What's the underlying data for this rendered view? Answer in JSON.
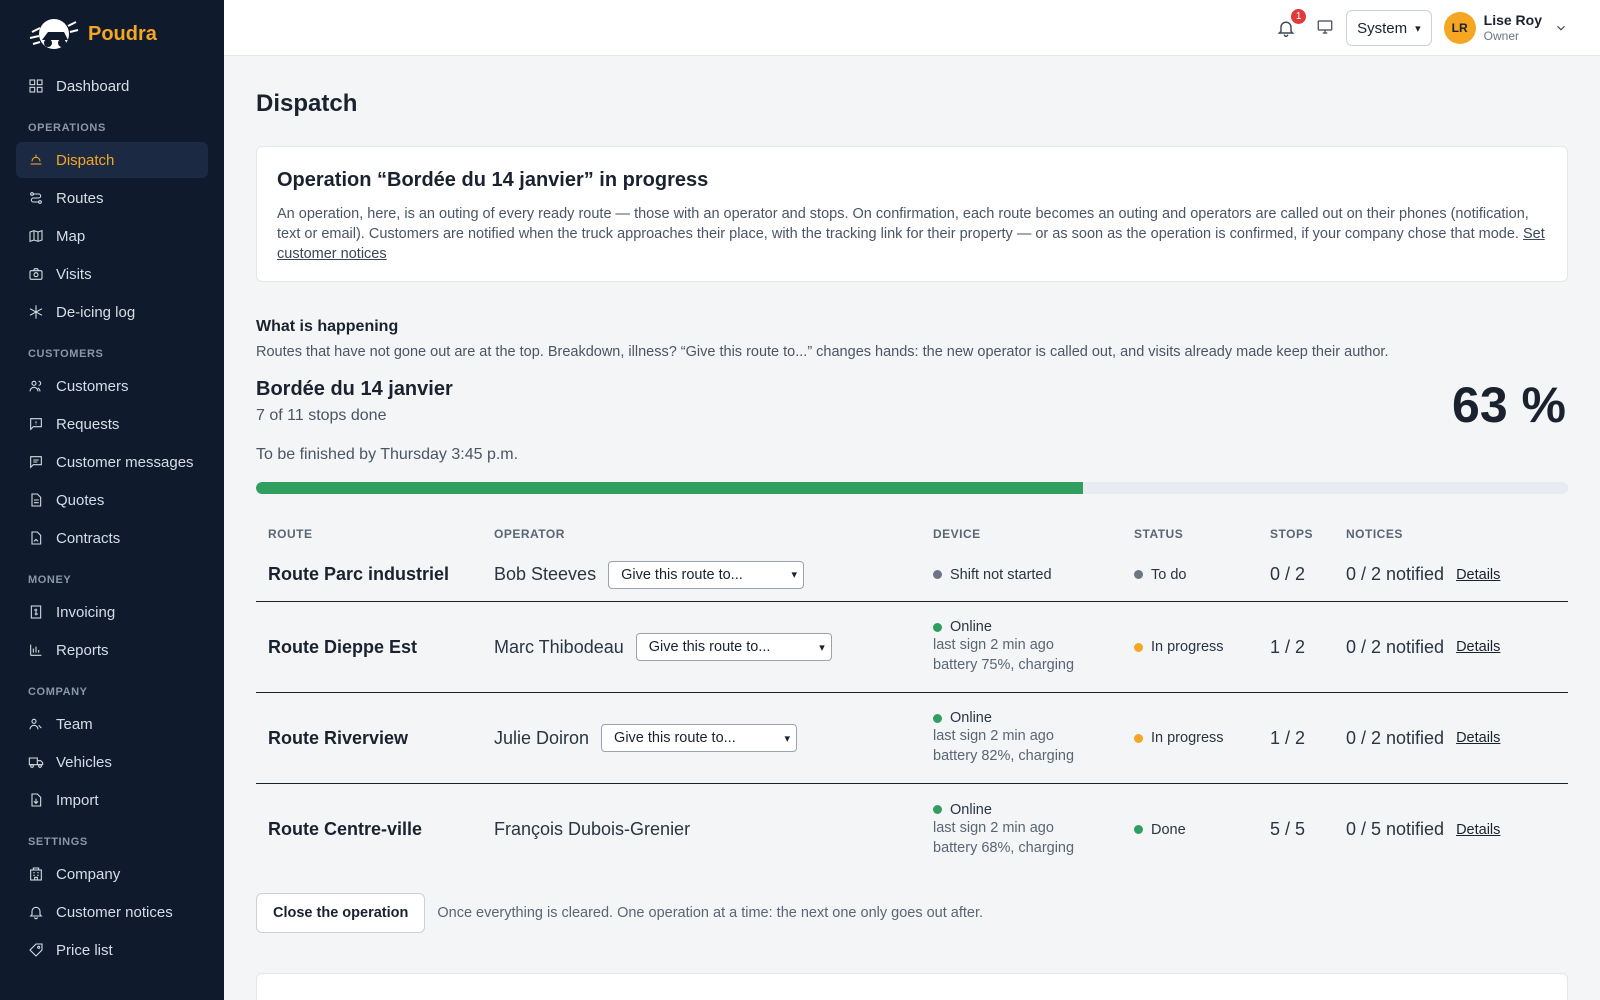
{
  "brand": {
    "name": "Poudra"
  },
  "sidebar": {
    "top_items": [
      {
        "label": "Dashboard",
        "icon": "dashboard-icon"
      }
    ],
    "sections": [
      {
        "title": "OPERATIONS",
        "items": [
          {
            "label": "Dispatch",
            "icon": "dispatch-icon",
            "active": true
          },
          {
            "label": "Routes",
            "icon": "routes-icon"
          },
          {
            "label": "Map",
            "icon": "map-icon"
          },
          {
            "label": "Visits",
            "icon": "camera-icon"
          },
          {
            "label": "De-icing log",
            "icon": "snowflake-icon"
          }
        ]
      },
      {
        "title": "CUSTOMERS",
        "items": [
          {
            "label": "Customers",
            "icon": "users-icon"
          },
          {
            "label": "Requests",
            "icon": "message-square-icon"
          },
          {
            "label": "Customer messages",
            "icon": "messages-icon"
          },
          {
            "label": "Quotes",
            "icon": "document-icon"
          },
          {
            "label": "Contracts",
            "icon": "contract-icon"
          }
        ]
      },
      {
        "title": "MONEY",
        "items": [
          {
            "label": "Invoicing",
            "icon": "invoice-icon"
          },
          {
            "label": "Reports",
            "icon": "bar-chart-icon"
          }
        ]
      },
      {
        "title": "COMPANY",
        "items": [
          {
            "label": "Team",
            "icon": "team-icon"
          },
          {
            "label": "Vehicles",
            "icon": "truck-icon"
          },
          {
            "label": "Import",
            "icon": "import-icon"
          }
        ]
      },
      {
        "title": "SETTINGS",
        "items": [
          {
            "label": "Company",
            "icon": "building-icon"
          },
          {
            "label": "Customer notices",
            "icon": "bell-icon"
          },
          {
            "label": "Price list",
            "icon": "tag-icon"
          }
        ]
      }
    ]
  },
  "topbar": {
    "notification_count": "1",
    "theme_value": "System",
    "user_initials": "LR",
    "user_name": "Lise Roy",
    "user_role": "Owner"
  },
  "page": {
    "title": "Dispatch"
  },
  "info_card": {
    "title": "Operation “Bordée du 14 janvier” in progress",
    "text": "An operation, here, is an outing of every ready route — those with an operator and stops. On confirmation, each route becomes an outing and operators are called out on their phones (notification, text or email). Customers are notified when the truck approaches their place, with the tracking link for their property — or as soon as the operation is confirmed, if your company chose that mode.",
    "link": "Set customer notices"
  },
  "happening": {
    "title": "What is happening",
    "text": "Routes that have not gone out are at the top. Breakdown, illness? “Give this route to...” changes hands: the new operator is called out, and visits already made keep their author."
  },
  "operation": {
    "name": "Bordée du 14 janvier",
    "progress_text": "7 of 11 stops done",
    "finish_text": "To be finished by Thursday 3:45 p.m.",
    "percent_label": "63 %",
    "progress_fraction": 0.63
  },
  "table": {
    "headers": {
      "route": "ROUTE",
      "operator": "OPERATOR",
      "device": "DEVICE",
      "status": "STATUS",
      "stops": "STOPS",
      "notices": "NOTICES"
    },
    "rows": [
      {
        "route": "Route Parc industriel",
        "operator": "Bob Steeves",
        "give_label": "Give this route to...",
        "device_status": "Shift not started",
        "device_color": "#6b7585",
        "device_sub1": "",
        "device_sub2": "",
        "status": "To do",
        "status_color": "#6b7585",
        "stops": "0 / 2",
        "notices": "0 / 2 notified",
        "details": "Details"
      },
      {
        "route": "Route Dieppe Est",
        "operator": "Marc Thibodeau",
        "give_label": "Give this route to...",
        "device_status": "Online",
        "device_color": "#2f9e5f",
        "device_sub1": "last sign 2 min ago",
        "device_sub2": "battery 75%, charging",
        "status": "In progress",
        "status_color": "#f5a623",
        "stops": "1 / 2",
        "notices": "0 / 2 notified",
        "details": "Details"
      },
      {
        "route": "Route Riverview",
        "operator": "Julie Doiron",
        "give_label": "Give this route to...",
        "device_status": "Online",
        "device_color": "#2f9e5f",
        "device_sub1": "last sign 2 min ago",
        "device_sub2": "battery 82%, charging",
        "status": "In progress",
        "status_color": "#f5a623",
        "stops": "1 / 2",
        "notices": "0 / 2 notified",
        "details": "Details"
      },
      {
        "route": "Route Centre-ville",
        "operator": "François Dubois-Grenier",
        "give_label": "",
        "device_status": "Online",
        "device_color": "#2f9e5f",
        "device_sub1": "last sign 2 min ago",
        "device_sub2": "battery 68%, charging",
        "status": "Done",
        "status_color": "#2f9e5f",
        "stops": "5 / 5",
        "notices": "0 / 5 notified",
        "details": "Details"
      }
    ]
  },
  "footer": {
    "close_button": "Close the operation",
    "close_note": "Once everything is cleared. One operation at a time: the next one only goes out after."
  },
  "colors": {
    "accent": "#f5a623",
    "sidebar_bg": "#0f1b2d",
    "progress": "#2f9e5f"
  }
}
